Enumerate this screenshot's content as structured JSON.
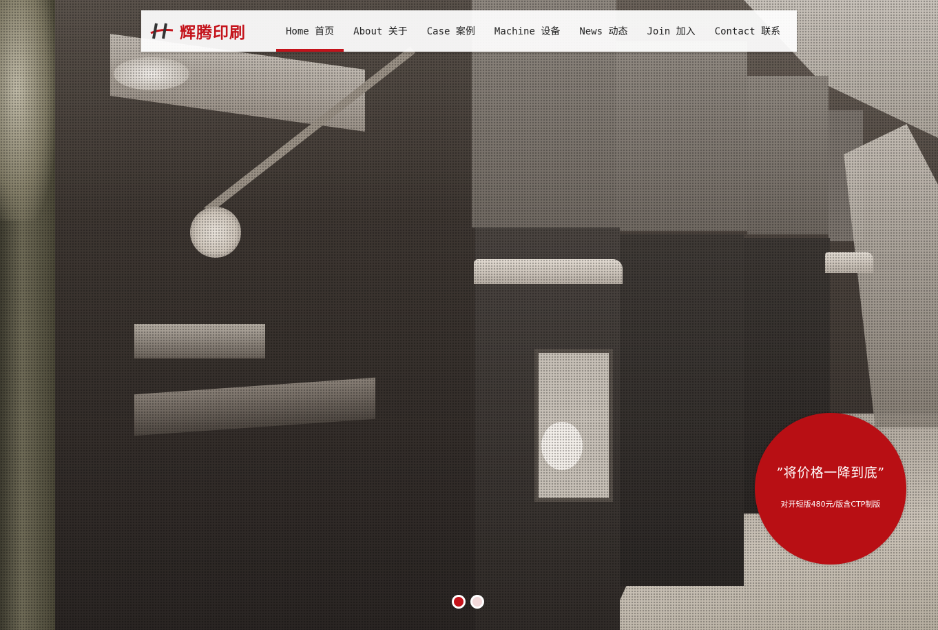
{
  "brand": {
    "name": "辉腾印刷",
    "accent_color": "#c4131b"
  },
  "nav": {
    "items": [
      {
        "label": "Home 首页",
        "active": true
      },
      {
        "label": "About 关于",
        "active": false
      },
      {
        "label": "Case 案例",
        "active": false
      },
      {
        "label": "Machine 设备",
        "active": false
      },
      {
        "label": "News 动态",
        "active": false
      },
      {
        "label": "Join 加入",
        "active": false
      },
      {
        "label": "Contact 联系",
        "active": false
      }
    ]
  },
  "promo": {
    "title": "”将价格一降到底”",
    "subtitle": "对开短版480元/版含CTP制版",
    "color": "#b80f14"
  },
  "slider": {
    "slide_count": 2,
    "active_index": 0
  }
}
